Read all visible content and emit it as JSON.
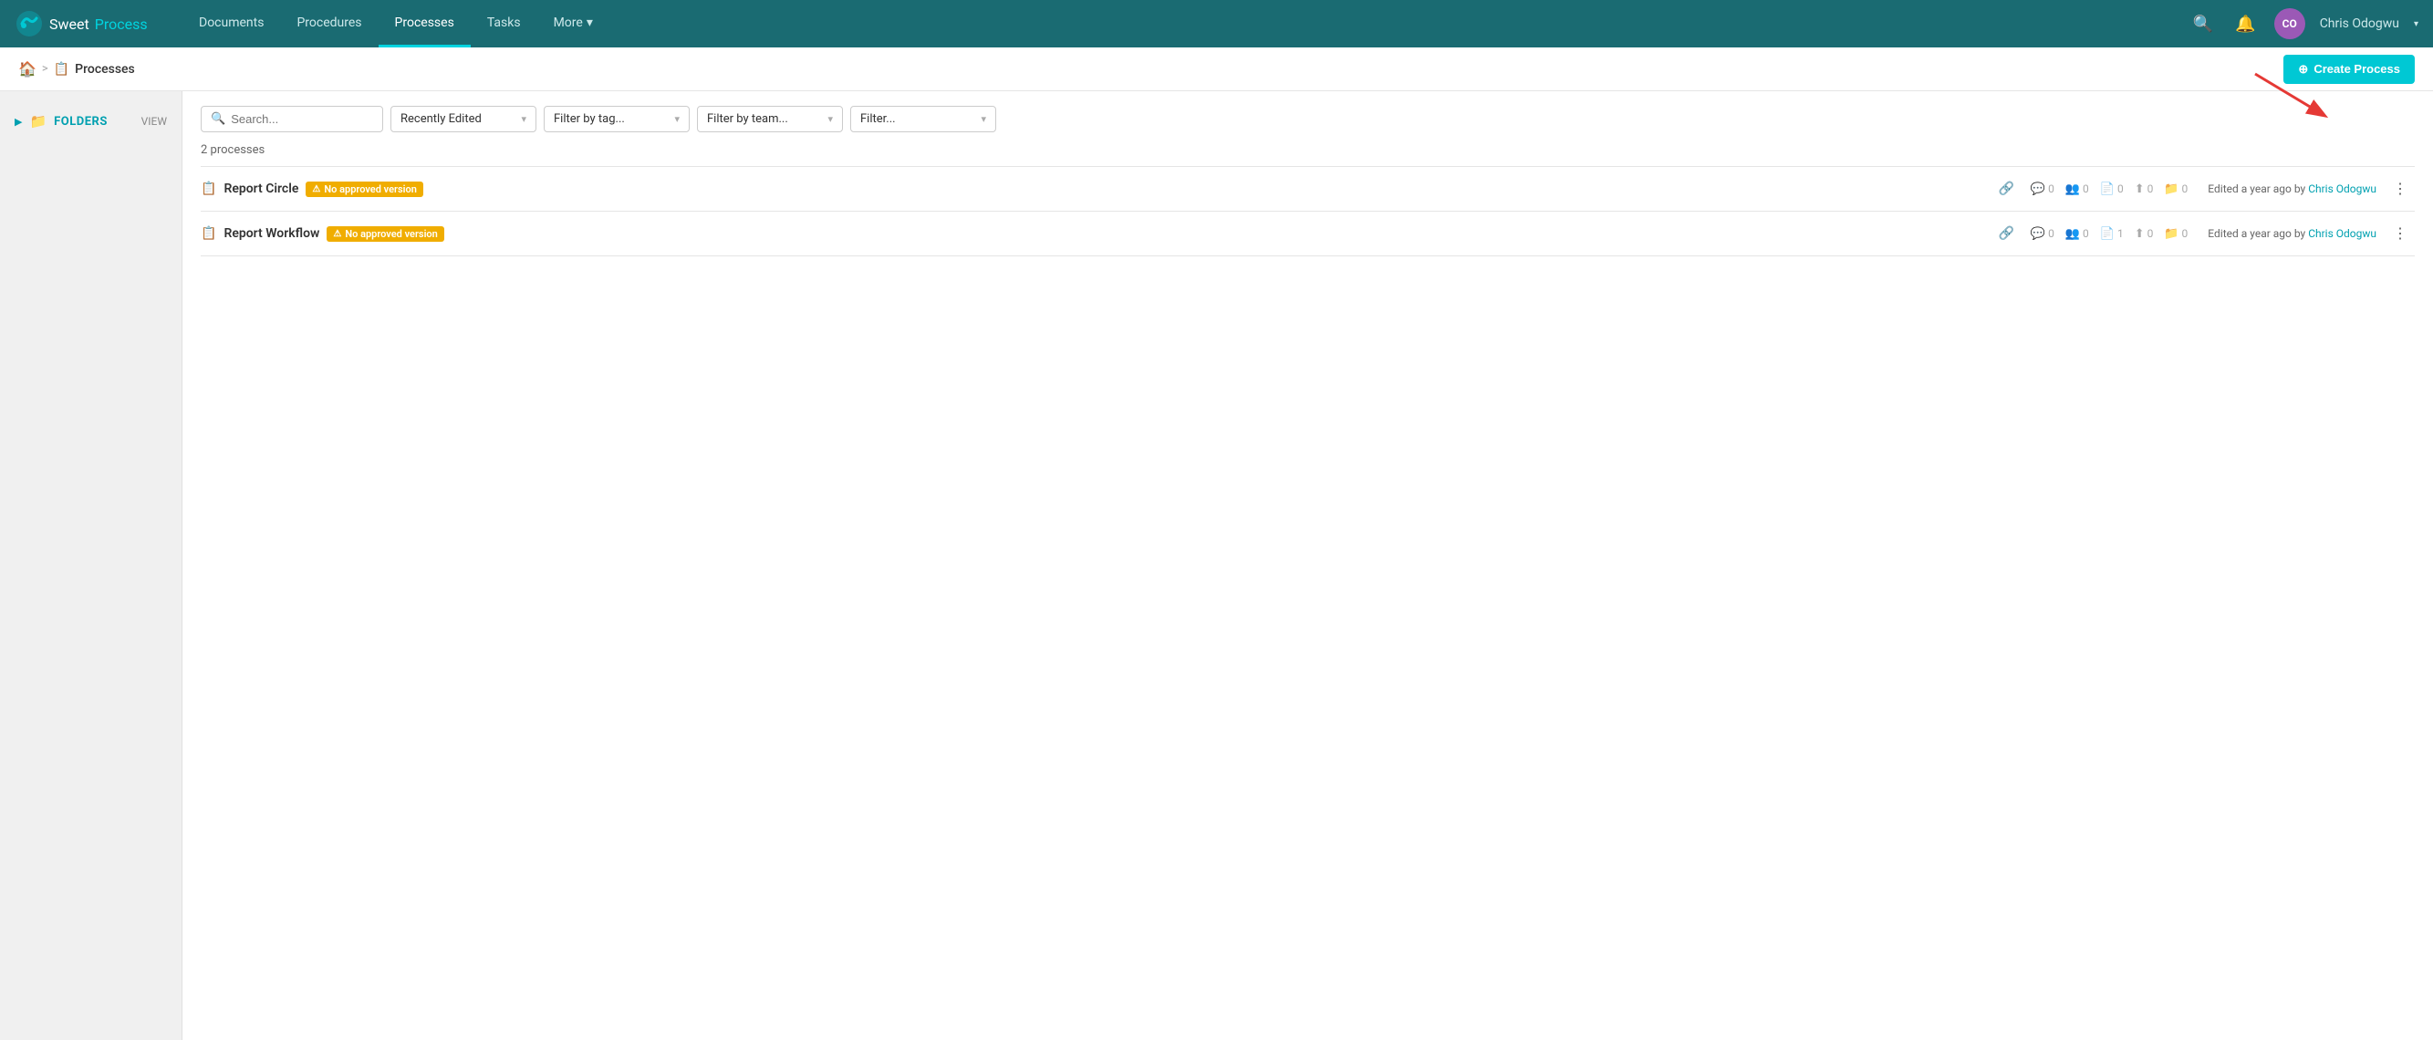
{
  "nav": {
    "logo_sweet": "Sweet",
    "logo_process": "Process",
    "links": [
      {
        "label": "Documents",
        "active": false
      },
      {
        "label": "Procedures",
        "active": false
      },
      {
        "label": "Processes",
        "active": true
      },
      {
        "label": "Tasks",
        "active": false
      },
      {
        "label": "More",
        "active": false,
        "has_chevron": true
      }
    ],
    "user_initials": "CO",
    "user_name": "Chris Odogwu"
  },
  "breadcrumb": {
    "home_icon": "🏠",
    "separator": ">",
    "page_icon": "📋",
    "current": "Processes"
  },
  "create_button": {
    "label": "Create Process",
    "plus": "+"
  },
  "sidebar": {
    "chevron": "▶",
    "folder_icon": "📁",
    "label": "FOLDERS",
    "view_label": "VIEW"
  },
  "filters": {
    "search_placeholder": "Search...",
    "recently_edited": "Recently Edited",
    "filter_by_tag": "Filter by tag...",
    "filter_by_team": "Filter by team...",
    "filter_label": "Filter..."
  },
  "process_count": "2 processes",
  "processes": [
    {
      "id": 1,
      "name": "Report Circle",
      "badge": "No approved version",
      "stats": {
        "comments": "0",
        "users": "0",
        "docs": "0",
        "uploads": "0",
        "folders": "0"
      },
      "edited_text": "Edited a year ago by",
      "edited_by": "Chris Odogwu"
    },
    {
      "id": 2,
      "name": "Report Workflow",
      "badge": "No approved version",
      "stats": {
        "comments": "0",
        "users": "0",
        "docs": "1",
        "uploads": "0",
        "folders": "0"
      },
      "edited_text": "Edited a year ago by",
      "edited_by": "Chris Odogwu"
    }
  ]
}
